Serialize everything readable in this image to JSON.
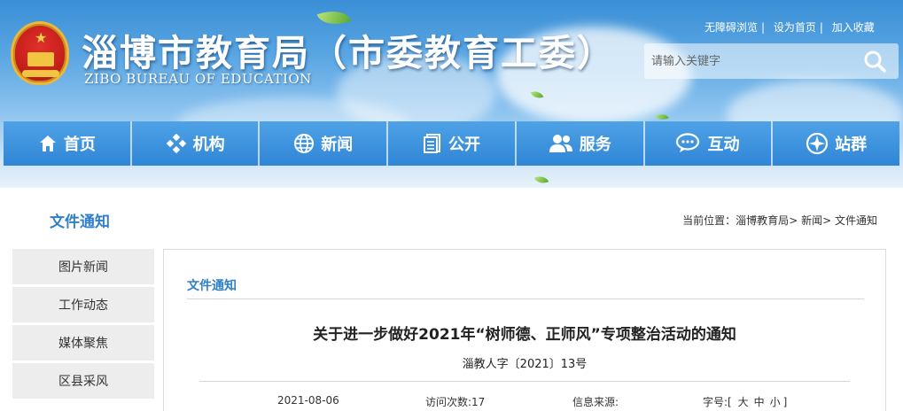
{
  "header": {
    "title": "淄博市教育局（市委教育工委）",
    "subtitle": "ZIBO BUREAU OF EDUCATION",
    "top_links": [
      "无障碍浏览",
      "设为首页",
      "加入收藏"
    ],
    "search": {
      "placeholder": "请输入关键字"
    }
  },
  "nav": {
    "items": [
      {
        "label": "首页",
        "icon": "home-icon"
      },
      {
        "label": "机构",
        "icon": "grid-icon"
      },
      {
        "label": "新闻",
        "icon": "globe-icon"
      },
      {
        "label": "公开",
        "icon": "document-icon"
      },
      {
        "label": "服务",
        "icon": "users-icon"
      },
      {
        "label": "互动",
        "icon": "chat-icon"
      },
      {
        "label": "站群",
        "icon": "sites-icon"
      }
    ]
  },
  "sidebar": {
    "title": "文件通知",
    "items": [
      "图片新闻",
      "工作动态",
      "媒体聚焦",
      "区县采风"
    ]
  },
  "breadcrumb": {
    "prefix": "当前位置：",
    "items": [
      "淄博教育局",
      "新闻",
      "文件通知"
    ],
    "separator": ">"
  },
  "article": {
    "category": "文件通知",
    "title": "关于进一步做好2021年“树师德、正师风”专项整治活动的通知",
    "doc_number": "淄教人字〔2021〕13号",
    "date": "2021-08-06",
    "views": "访问次数:17",
    "source": "信息来源:",
    "font_size_label": "字号:",
    "font_size_open": "[",
    "font_sizes": [
      "大",
      "中",
      "小"
    ],
    "font_size_close": "]"
  },
  "colors": {
    "brand_blue": "#2f7fc9",
    "nav_blue": "#3b8ddb",
    "sidebar_item_bg": "#ededed"
  }
}
